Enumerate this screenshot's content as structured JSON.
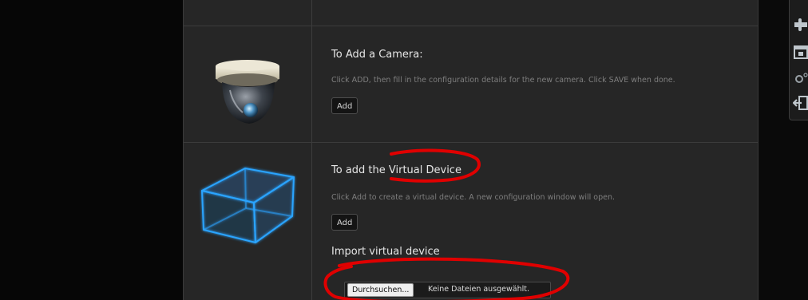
{
  "camera": {
    "title": "To Add a Camera:",
    "description": "Click ADD, then fill in the configuration details for the new camera. Click SAVE when done.",
    "add_label": "Add",
    "icon": "dome-camera-icon"
  },
  "virtual": {
    "title": "To add the Virtual Device",
    "description": "Click Add to create a virtual device. A new configuration window will open.",
    "add_label": "Add",
    "icon": "wireframe-cube-icon",
    "import_title": "Import virtual device",
    "browse_label": "Durchsuchen...",
    "file_status": "Keine Dateien ausgewählt."
  },
  "toolbar": {
    "icons": [
      "puzzle-icon",
      "calendar-icon",
      "gear-icon",
      "logout-icon"
    ]
  },
  "colors": {
    "panel": "#262626",
    "annotation": "#e00000",
    "cube": "#2aa4ff"
  }
}
